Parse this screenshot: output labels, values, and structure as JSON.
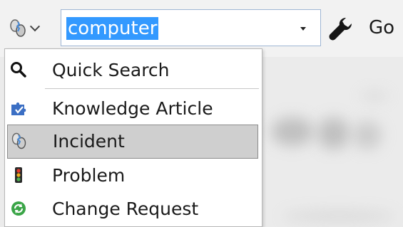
{
  "search": {
    "value": "computer"
  },
  "toolbar": {
    "go_label": "Go"
  },
  "menu": {
    "items": [
      {
        "label": "Quick Search",
        "icon": "magnifier-icon"
      },
      {
        "label": "Knowledge Article",
        "icon": "puzzle-icon"
      },
      {
        "label": "Incident",
        "icon": "incident-icon",
        "selected": true
      },
      {
        "label": "Problem",
        "icon": "traffic-light-icon"
      },
      {
        "label": "Change Request",
        "icon": "recycle-icon"
      }
    ]
  },
  "colors": {
    "selection_highlight": "#3399ff",
    "menu_selected_bg": "#cfcfcf"
  }
}
